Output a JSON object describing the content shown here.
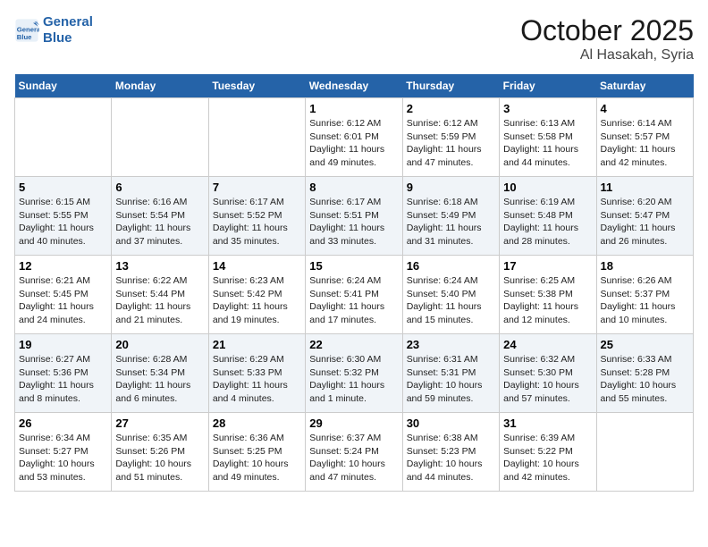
{
  "logo": {
    "line1": "General",
    "line2": "Blue"
  },
  "title": "October 2025",
  "location": "Al Hasakah, Syria",
  "weekdays": [
    "Sunday",
    "Monday",
    "Tuesday",
    "Wednesday",
    "Thursday",
    "Friday",
    "Saturday"
  ],
  "weeks": [
    [
      {
        "day": "",
        "info": ""
      },
      {
        "day": "",
        "info": ""
      },
      {
        "day": "",
        "info": ""
      },
      {
        "day": "1",
        "info": "Sunrise: 6:12 AM\nSunset: 6:01 PM\nDaylight: 11 hours\nand 49 minutes."
      },
      {
        "day": "2",
        "info": "Sunrise: 6:12 AM\nSunset: 5:59 PM\nDaylight: 11 hours\nand 47 minutes."
      },
      {
        "day": "3",
        "info": "Sunrise: 6:13 AM\nSunset: 5:58 PM\nDaylight: 11 hours\nand 44 minutes."
      },
      {
        "day": "4",
        "info": "Sunrise: 6:14 AM\nSunset: 5:57 PM\nDaylight: 11 hours\nand 42 minutes."
      }
    ],
    [
      {
        "day": "5",
        "info": "Sunrise: 6:15 AM\nSunset: 5:55 PM\nDaylight: 11 hours\nand 40 minutes."
      },
      {
        "day": "6",
        "info": "Sunrise: 6:16 AM\nSunset: 5:54 PM\nDaylight: 11 hours\nand 37 minutes."
      },
      {
        "day": "7",
        "info": "Sunrise: 6:17 AM\nSunset: 5:52 PM\nDaylight: 11 hours\nand 35 minutes."
      },
      {
        "day": "8",
        "info": "Sunrise: 6:17 AM\nSunset: 5:51 PM\nDaylight: 11 hours\nand 33 minutes."
      },
      {
        "day": "9",
        "info": "Sunrise: 6:18 AM\nSunset: 5:49 PM\nDaylight: 11 hours\nand 31 minutes."
      },
      {
        "day": "10",
        "info": "Sunrise: 6:19 AM\nSunset: 5:48 PM\nDaylight: 11 hours\nand 28 minutes."
      },
      {
        "day": "11",
        "info": "Sunrise: 6:20 AM\nSunset: 5:47 PM\nDaylight: 11 hours\nand 26 minutes."
      }
    ],
    [
      {
        "day": "12",
        "info": "Sunrise: 6:21 AM\nSunset: 5:45 PM\nDaylight: 11 hours\nand 24 minutes."
      },
      {
        "day": "13",
        "info": "Sunrise: 6:22 AM\nSunset: 5:44 PM\nDaylight: 11 hours\nand 21 minutes."
      },
      {
        "day": "14",
        "info": "Sunrise: 6:23 AM\nSunset: 5:42 PM\nDaylight: 11 hours\nand 19 minutes."
      },
      {
        "day": "15",
        "info": "Sunrise: 6:24 AM\nSunset: 5:41 PM\nDaylight: 11 hours\nand 17 minutes."
      },
      {
        "day": "16",
        "info": "Sunrise: 6:24 AM\nSunset: 5:40 PM\nDaylight: 11 hours\nand 15 minutes."
      },
      {
        "day": "17",
        "info": "Sunrise: 6:25 AM\nSunset: 5:38 PM\nDaylight: 11 hours\nand 12 minutes."
      },
      {
        "day": "18",
        "info": "Sunrise: 6:26 AM\nSunset: 5:37 PM\nDaylight: 11 hours\nand 10 minutes."
      }
    ],
    [
      {
        "day": "19",
        "info": "Sunrise: 6:27 AM\nSunset: 5:36 PM\nDaylight: 11 hours\nand 8 minutes."
      },
      {
        "day": "20",
        "info": "Sunrise: 6:28 AM\nSunset: 5:34 PM\nDaylight: 11 hours\nand 6 minutes."
      },
      {
        "day": "21",
        "info": "Sunrise: 6:29 AM\nSunset: 5:33 PM\nDaylight: 11 hours\nand 4 minutes."
      },
      {
        "day": "22",
        "info": "Sunrise: 6:30 AM\nSunset: 5:32 PM\nDaylight: 11 hours\nand 1 minute."
      },
      {
        "day": "23",
        "info": "Sunrise: 6:31 AM\nSunset: 5:31 PM\nDaylight: 10 hours\nand 59 minutes."
      },
      {
        "day": "24",
        "info": "Sunrise: 6:32 AM\nSunset: 5:30 PM\nDaylight: 10 hours\nand 57 minutes."
      },
      {
        "day": "25",
        "info": "Sunrise: 6:33 AM\nSunset: 5:28 PM\nDaylight: 10 hours\nand 55 minutes."
      }
    ],
    [
      {
        "day": "26",
        "info": "Sunrise: 6:34 AM\nSunset: 5:27 PM\nDaylight: 10 hours\nand 53 minutes."
      },
      {
        "day": "27",
        "info": "Sunrise: 6:35 AM\nSunset: 5:26 PM\nDaylight: 10 hours\nand 51 minutes."
      },
      {
        "day": "28",
        "info": "Sunrise: 6:36 AM\nSunset: 5:25 PM\nDaylight: 10 hours\nand 49 minutes."
      },
      {
        "day": "29",
        "info": "Sunrise: 6:37 AM\nSunset: 5:24 PM\nDaylight: 10 hours\nand 47 minutes."
      },
      {
        "day": "30",
        "info": "Sunrise: 6:38 AM\nSunset: 5:23 PM\nDaylight: 10 hours\nand 44 minutes."
      },
      {
        "day": "31",
        "info": "Sunrise: 6:39 AM\nSunset: 5:22 PM\nDaylight: 10 hours\nand 42 minutes."
      },
      {
        "day": "",
        "info": ""
      }
    ]
  ]
}
